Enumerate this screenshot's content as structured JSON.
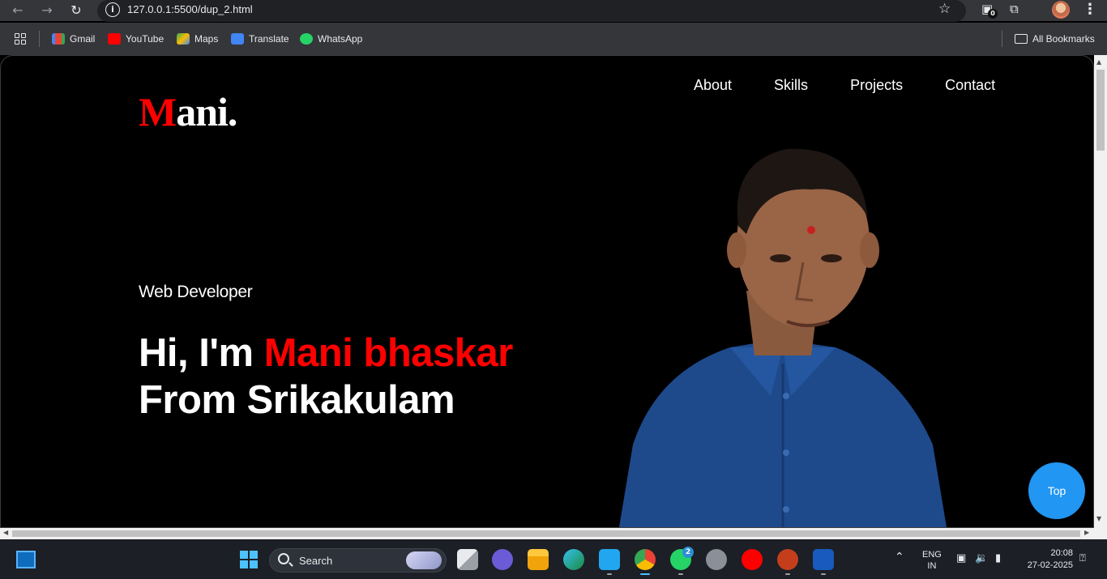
{
  "browser": {
    "url": "127.0.0.1:5500/dup_2.html",
    "extension_badge": "0",
    "bookmarks": [
      {
        "label": "Gmail",
        "icon": "gmail-icon",
        "color": "#ea4335"
      },
      {
        "label": "YouTube",
        "icon": "youtube-icon",
        "color": "#ff0000"
      },
      {
        "label": "Maps",
        "icon": "maps-icon",
        "color": "#34a853"
      },
      {
        "label": "Translate",
        "icon": "translate-icon",
        "color": "#4285f4"
      },
      {
        "label": "WhatsApp",
        "icon": "whatsapp-icon",
        "color": "#25d366"
      }
    ],
    "all_bookmarks_label": "All Bookmarks"
  },
  "page": {
    "logo_first": "M",
    "logo_rest": "ani.",
    "nav": [
      "About",
      "Skills",
      "Projects",
      "Contact"
    ],
    "role": "Web Developer",
    "headline_prefix": "Hi, I'm ",
    "headline_name": "Mani bhaskar",
    "headline_line2": "From Srikakulam",
    "top_button": "Top",
    "accent_color": "#ff0000",
    "button_color": "#2196f3"
  },
  "taskbar": {
    "search_placeholder": "Search",
    "whatsapp_badge": "2",
    "language_line1": "ENG",
    "language_line2": "IN",
    "time": "20:08",
    "date": "27-02-2025"
  }
}
